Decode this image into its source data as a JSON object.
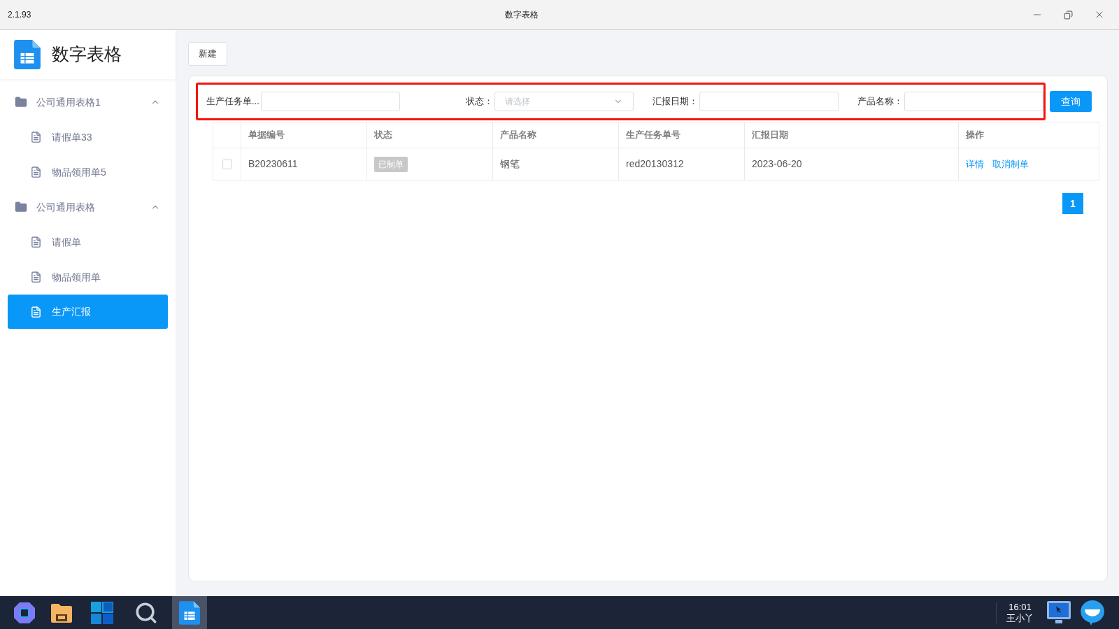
{
  "window": {
    "version": "2.1.93",
    "title": "数字表格"
  },
  "sidebar": {
    "app_name": "数字表格",
    "groups": [
      {
        "label": "公司通用表格1",
        "expanded": true,
        "children": [
          {
            "label": "请假单33",
            "selected": false
          },
          {
            "label": "物品领用单5",
            "selected": false
          }
        ]
      },
      {
        "label": "公司通用表格",
        "expanded": true,
        "children": [
          {
            "label": "请假单",
            "selected": false
          },
          {
            "label": "物品领用单",
            "selected": false
          },
          {
            "label": "生产汇报",
            "selected": true
          }
        ]
      }
    ]
  },
  "toolbar": {
    "new_button": "新建"
  },
  "filters": [
    {
      "kind": "text",
      "label": "生产任务单..."
    },
    {
      "kind": "select",
      "label": "状态：",
      "placeholder": "请选择"
    },
    {
      "kind": "text",
      "label": "汇报日期："
    },
    {
      "kind": "text",
      "label": "产品名称："
    }
  ],
  "query_button": "查询",
  "table": {
    "columns": [
      "单据编号",
      "状态",
      "产品名称",
      "生产任务单号",
      "汇报日期",
      "操作"
    ],
    "rows": [
      {
        "checked": false,
        "cells": [
          "B20230611",
          "已制单",
          "钢笔",
          "red20130312",
          "2023-06-20"
        ],
        "actions": [
          "详情",
          "取消制单"
        ]
      }
    ]
  },
  "pagination": [
    {
      "label": "1",
      "selected": true
    }
  ],
  "taskbar": {
    "time": "16:01",
    "user": "王小丫"
  }
}
